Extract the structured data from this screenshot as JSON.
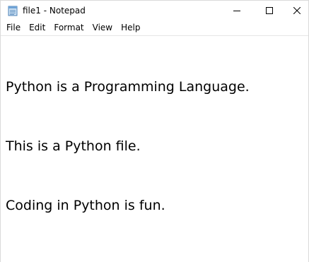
{
  "window": {
    "title": "file1 - Notepad",
    "app_icon": "notepad-icon",
    "controls": {
      "minimize": "minimize-icon",
      "maximize": "maximize-icon",
      "close": "close-icon"
    }
  },
  "menu": {
    "items": [
      "File",
      "Edit",
      "Format",
      "View",
      "Help"
    ]
  },
  "editor": {
    "lines": [
      "Python is a Programming Language.",
      "This is a Python file.",
      "Coding in Python is fun."
    ]
  },
  "colors": {
    "background": "#ffffff",
    "text": "#000000",
    "border": "#dadada"
  }
}
